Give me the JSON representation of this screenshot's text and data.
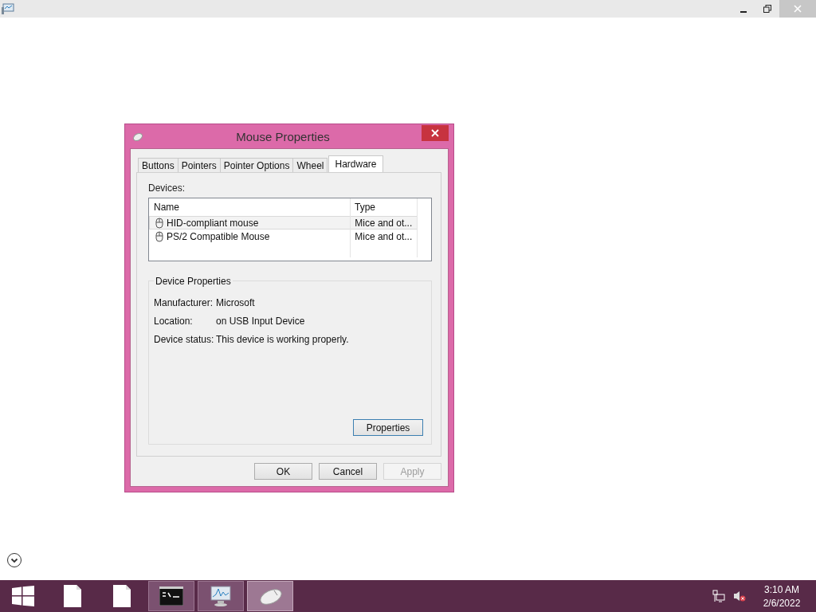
{
  "dialog": {
    "title": "Mouse Properties",
    "tabs": [
      {
        "label": "Buttons",
        "selected": false
      },
      {
        "label": "Pointers",
        "selected": false
      },
      {
        "label": "Pointer Options",
        "selected": false
      },
      {
        "label": "Wheel",
        "selected": false
      },
      {
        "label": "Hardware",
        "selected": true
      }
    ],
    "devices_label": "Devices:",
    "table": {
      "columns": [
        "Name",
        "Type"
      ],
      "rows": [
        {
          "name": "HID-compliant mouse",
          "type": "Mice and ot...",
          "selected": true
        },
        {
          "name": "PS/2 Compatible Mouse",
          "type": "Mice and ot...",
          "selected": false
        }
      ]
    },
    "group": {
      "title": "Device Properties",
      "fields": [
        {
          "label": "Manufacturer:",
          "value": "Microsoft"
        },
        {
          "label": "Location:",
          "value": "on USB Input Device"
        },
        {
          "label": "Device status:",
          "value": "This device is working properly."
        }
      ],
      "button": {
        "label": "Properties",
        "focused": true,
        "disabled": false
      }
    },
    "buttons": [
      {
        "label": "OK",
        "focused": false,
        "disabled": false
      },
      {
        "label": "Cancel",
        "focused": false,
        "disabled": false
      },
      {
        "label": "Apply",
        "focused": false,
        "disabled": true
      }
    ]
  },
  "taskbar": {
    "items": [
      {
        "kind": "start",
        "selected": false
      },
      {
        "kind": "file",
        "selected": false
      },
      {
        "kind": "file",
        "selected": false
      },
      {
        "kind": "console",
        "selected": false
      },
      {
        "kind": "monitor",
        "selected": false
      },
      {
        "kind": "mouse",
        "selected": true
      }
    ],
    "clock": {
      "time": "3:10 AM",
      "date": "2/6/2022"
    }
  }
}
